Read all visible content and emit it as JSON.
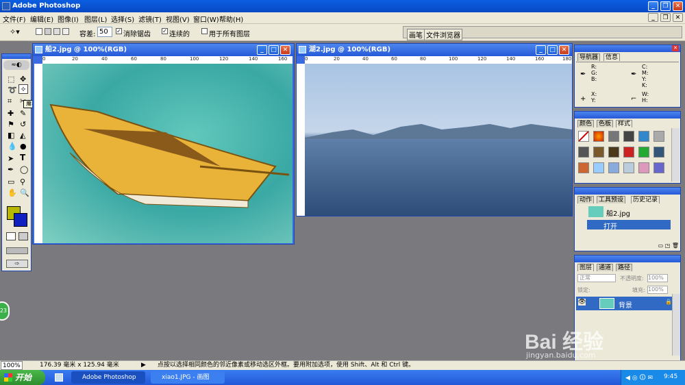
{
  "app": {
    "title": "Adobe Photoshop"
  },
  "menu": {
    "items": [
      "文件(F)",
      "编辑(E)",
      "图像(I)",
      "图层(L)",
      "选择(S)",
      "滤镜(T)",
      "视图(V)",
      "窗口(W)",
      "帮助(H)"
    ]
  },
  "options": {
    "tolerance_label": "容差:",
    "tolerance_value": "50",
    "antialias_label": "消除锯齿",
    "contiguous_label": "连续的",
    "all_layers_label": "用于所有图层",
    "palette_well": [
      "画笔",
      "文件浏览器"
    ]
  },
  "tool_tip": "魔棒工具 (W)",
  "doc1": {
    "title": "船2.jpg @ 100%(RGB)",
    "ruler_x": [
      "0",
      "20",
      "40",
      "60",
      "80",
      "100",
      "120",
      "140",
      "160"
    ],
    "ruler_y": [
      "0",
      "2",
      "4",
      "6",
      "8",
      "10",
      "12"
    ]
  },
  "doc2": {
    "title": "湖2.jpg @ 100%(RGB)",
    "ruler_x": [
      "0",
      "20",
      "40",
      "60",
      "80",
      "100",
      "120",
      "140",
      "160",
      "180"
    ],
    "ruler_y": [
      "0",
      "2",
      "4",
      "6",
      "8",
      "10",
      "12"
    ]
  },
  "nav_panel": {
    "tabs": [
      "导航器",
      "信息"
    ],
    "rgb": "R:\nG:\nB:",
    "cmyk": "C:\nM:\nY:\nK:",
    "xy": "X:\nY:",
    "wh": "W:\nH:"
  },
  "color_panel": {
    "tabs": [
      "颜色",
      "色板",
      "样式"
    ]
  },
  "history_panel": {
    "tabs": [
      "动作",
      "工具预设",
      "历史记录"
    ],
    "snapshot": "船2.jpg",
    "step": "打开"
  },
  "layers_panel": {
    "tabs": [
      "图层",
      "通道",
      "路径"
    ],
    "mode": "正常",
    "opacity_label": "不透明度:",
    "opacity_value": "100%",
    "lock_label": "锁定:",
    "fill_label": "填充:",
    "fill_value": "100%",
    "layer_name": "背景"
  },
  "status": {
    "zoom": "100%",
    "size": "176.39 毫米 x 125.94 毫米",
    "hint": "点按以选择相同颜色的邻近像素或移动选区外框。要用附加选项，使用 Shift、Alt 和 Ctrl 键。"
  },
  "taskbar": {
    "start": "开始",
    "tasks": [
      "Adobe Photoshop",
      "xiao1.JPG - 画图"
    ],
    "time": "9:45"
  },
  "watermark": {
    "brand": "Bai 经验",
    "url": "jingyan.baidu.com"
  },
  "badge": "23",
  "colors": {
    "foreground": "#b9b800",
    "background": "#1020c0"
  }
}
